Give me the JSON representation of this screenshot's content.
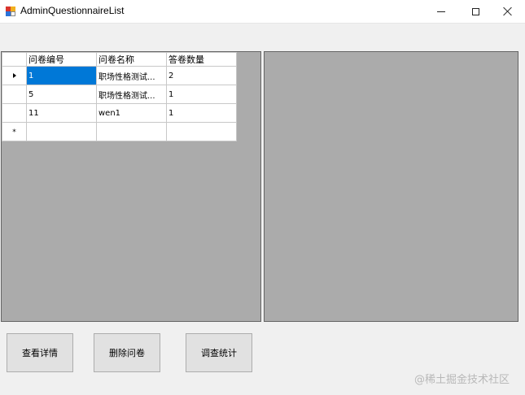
{
  "window": {
    "title": "AdminQuestionnaireList"
  },
  "grid": {
    "columns": [
      "问卷编号",
      "问卷名称",
      "答卷数量"
    ],
    "rows": [
      {
        "id": "1",
        "name": "职场性格测试...",
        "count": "2"
      },
      {
        "id": "5",
        "name": "职场性格测试...",
        "count": "1"
      },
      {
        "id": "11",
        "name": "wen1",
        "count": "1"
      }
    ],
    "new_row_marker": "*"
  },
  "buttons": {
    "view_details": "查看详情",
    "delete": "删除问卷",
    "statistics": "调查统计"
  },
  "watermark": "@稀土掘金技术社区",
  "colors": {
    "selection": "#0078d7",
    "panel_background": "#ababab"
  }
}
